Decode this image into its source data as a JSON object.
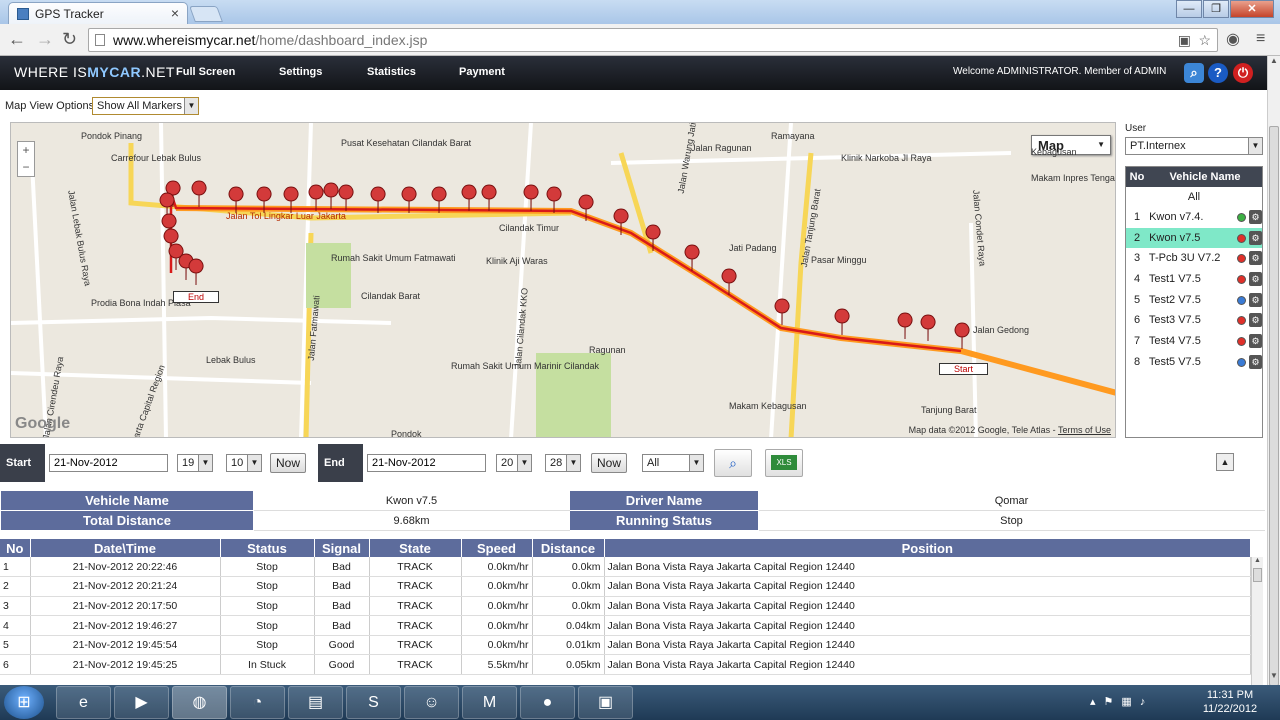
{
  "browser": {
    "tab_title": "GPS Tracker",
    "url_domain": "www.whereismycar.net",
    "url_path": "/home/dashboard_index.jsp"
  },
  "site": {
    "logo_left": "WHERE IS",
    "logo_bold": "MYCAR",
    "logo_right": ".NET",
    "menu": [
      "Full Screen",
      "Settings",
      "Statistics",
      "Payment"
    ],
    "welcome": "Welcome ADMINISTRATOR. Member of ADMIN"
  },
  "map_view": {
    "label": "Map View Options",
    "selected": "Show All Markers"
  },
  "map": {
    "type": "Map",
    "attribution": "Map data ©2012 Google, Tele Atlas - ",
    "terms": "Terms of Use",
    "brand": "Google",
    "labels": [
      "Carrefour Lebak Bulus",
      "Pondok Pinang",
      "Pusat Kesehatan Cilandak Barat",
      "Cilandak Timur",
      "Jalan Ragunan",
      "Jati Padang",
      "Pasar Minggu",
      "Cilandak Barat",
      "Rumah Sakit Umum Fatmawati",
      "Ragunan",
      "Lebak Bulus",
      "Prodia Bona Indah Plasa",
      "Jalan Tol Lingkar Luar Jakarta",
      "Jalan Fatmawati",
      "Jalan Cilandak KKO",
      "Jalan Tanjung Barat",
      "Jalan Gedong",
      "Tanjung Barat",
      "Makam Kebagusan",
      "Pondok",
      "Jalan Lebak Bulus Raya",
      "Jalan Cirendeu Raya",
      "Jakarta Capital Region",
      "Klinik Aji Waras",
      "Jalan Condet Raya",
      "Rumah Sakit Umum Marinir Cilandak",
      "Jalan Warung Jati",
      "Ramayana",
      "Klinik Narkoba Jl Raya",
      "Makam Inpres Tengah",
      "Kebagusan"
    ],
    "start_label": "Start",
    "end_label": "End"
  },
  "user_panel": {
    "label": "User",
    "selected_user": "PT.Internex",
    "col_no": "No",
    "col_name": "Vehicle Name",
    "all": "All",
    "vehicles": [
      {
        "no": "1",
        "name": "Kwon v7.4.",
        "status_color": "#3cb043"
      },
      {
        "no": "2",
        "name": "Kwon v7.5",
        "status_color": "#e0302a"
      },
      {
        "no": "3",
        "name": "T-Pcb 3U V7.2",
        "status_color": "#e0302a"
      },
      {
        "no": "4",
        "name": "Test1 V7.5",
        "status_color": "#e0302a"
      },
      {
        "no": "5",
        "name": "Test2 V7.5",
        "status_color": "#3a7bd5"
      },
      {
        "no": "6",
        "name": "Test3 V7.5",
        "status_color": "#e0302a"
      },
      {
        "no": "7",
        "name": "Test4 V7.5",
        "status_color": "#e0302a"
      },
      {
        "no": "8",
        "name": "Test5 V7.5",
        "status_color": "#3a7bd5"
      }
    ]
  },
  "controls": {
    "start_label": "Start",
    "start_date": "21-Nov-2012",
    "start_hour": "19",
    "start_min": "10",
    "now1": "Now",
    "end_label": "End",
    "end_date": "21-Nov-2012",
    "end_hour": "20",
    "end_min": "28",
    "now2": "Now",
    "filter": "All",
    "excel": "XLS"
  },
  "summary": {
    "vehicle_name_label": "Vehicle Name",
    "vehicle_name": "Kwon v7.5",
    "driver_name_label": "Driver Name",
    "driver_name": "Qomar",
    "total_distance_label": "Total Distance",
    "total_distance": "9.68km",
    "running_status_label": "Running Status",
    "running_status": "Stop"
  },
  "log_table": {
    "headers": [
      "No",
      "Date\\Time",
      "Status",
      "Signal",
      "State",
      "Speed",
      "Distance",
      "Position"
    ],
    "rows": [
      [
        "1",
        "21-Nov-2012 20:22:46",
        "Stop",
        "Bad",
        "TRACK",
        "0.0km/hr",
        "0.0km",
        "Jalan Bona Vista Raya Jakarta Capital Region 12440"
      ],
      [
        "2",
        "21-Nov-2012 20:21:24",
        "Stop",
        "Bad",
        "TRACK",
        "0.0km/hr",
        "0.0km",
        "Jalan Bona Vista Raya Jakarta Capital Region 12440"
      ],
      [
        "3",
        "21-Nov-2012 20:17:50",
        "Stop",
        "Bad",
        "TRACK",
        "0.0km/hr",
        "0.0km",
        "Jalan Bona Vista Raya Jakarta Capital Region 12440"
      ],
      [
        "4",
        "21-Nov-2012 19:46:27",
        "Stop",
        "Bad",
        "TRACK",
        "0.0km/hr",
        "0.04km",
        "Jalan Bona Vista Raya Jakarta Capital Region 12440"
      ],
      [
        "5",
        "21-Nov-2012 19:45:54",
        "Stop",
        "Good",
        "TRACK",
        "0.0km/hr",
        "0.01km",
        "Jalan Bona Vista Raya Jakarta Capital Region 12440"
      ],
      [
        "6",
        "21-Nov-2012 19:45:25",
        "In Stuck",
        "Good",
        "TRACK",
        "5.5km/hr",
        "0.05km",
        "Jalan Bona Vista Raya Jakarta Capital Region 12440"
      ]
    ]
  },
  "taskbar": {
    "time": "11:31 PM",
    "date": "11/22/2012"
  }
}
